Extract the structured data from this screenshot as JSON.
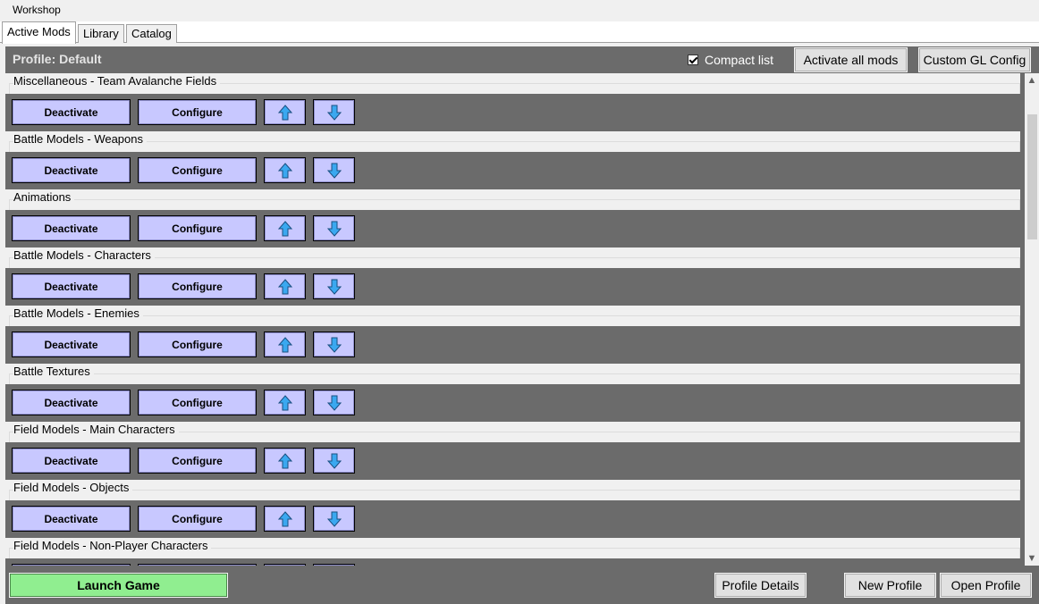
{
  "menubar": {
    "title": "Workshop"
  },
  "tabs": [
    {
      "label": "Active Mods",
      "active": true
    },
    {
      "label": "Library",
      "active": false
    },
    {
      "label": "Catalog",
      "active": false
    }
  ],
  "profile": {
    "title": "Profile: Default",
    "compact_label": "Compact list",
    "compact_checked": true,
    "activate_all_label": "Activate all mods",
    "gl_config_label": "Custom GL Config"
  },
  "mod_buttons": {
    "deactivate": "Deactivate",
    "configure": "Configure"
  },
  "mods": [
    {
      "name": "Miscellaneous - Team Avalanche Fields"
    },
    {
      "name": "Battle Models - Weapons"
    },
    {
      "name": "Animations"
    },
    {
      "name": "Battle Models - Characters"
    },
    {
      "name": "Battle Models - Enemies"
    },
    {
      "name": "Battle Textures"
    },
    {
      "name": "Field Models - Main Characters"
    },
    {
      "name": "Field Models - Objects"
    },
    {
      "name": "Field Models - Non-Player Characters"
    }
  ],
  "footer": {
    "launch_label": "Launch Game",
    "details_label": "Profile Details",
    "new_label": "New Profile",
    "open_label": "Open Profile"
  },
  "colors": {
    "panel_bg": "#6b6b6b",
    "mod_button_bg": "#c8c8ff",
    "launch_bg": "#90ee90",
    "arrow_fill": "#3aa8f0"
  }
}
